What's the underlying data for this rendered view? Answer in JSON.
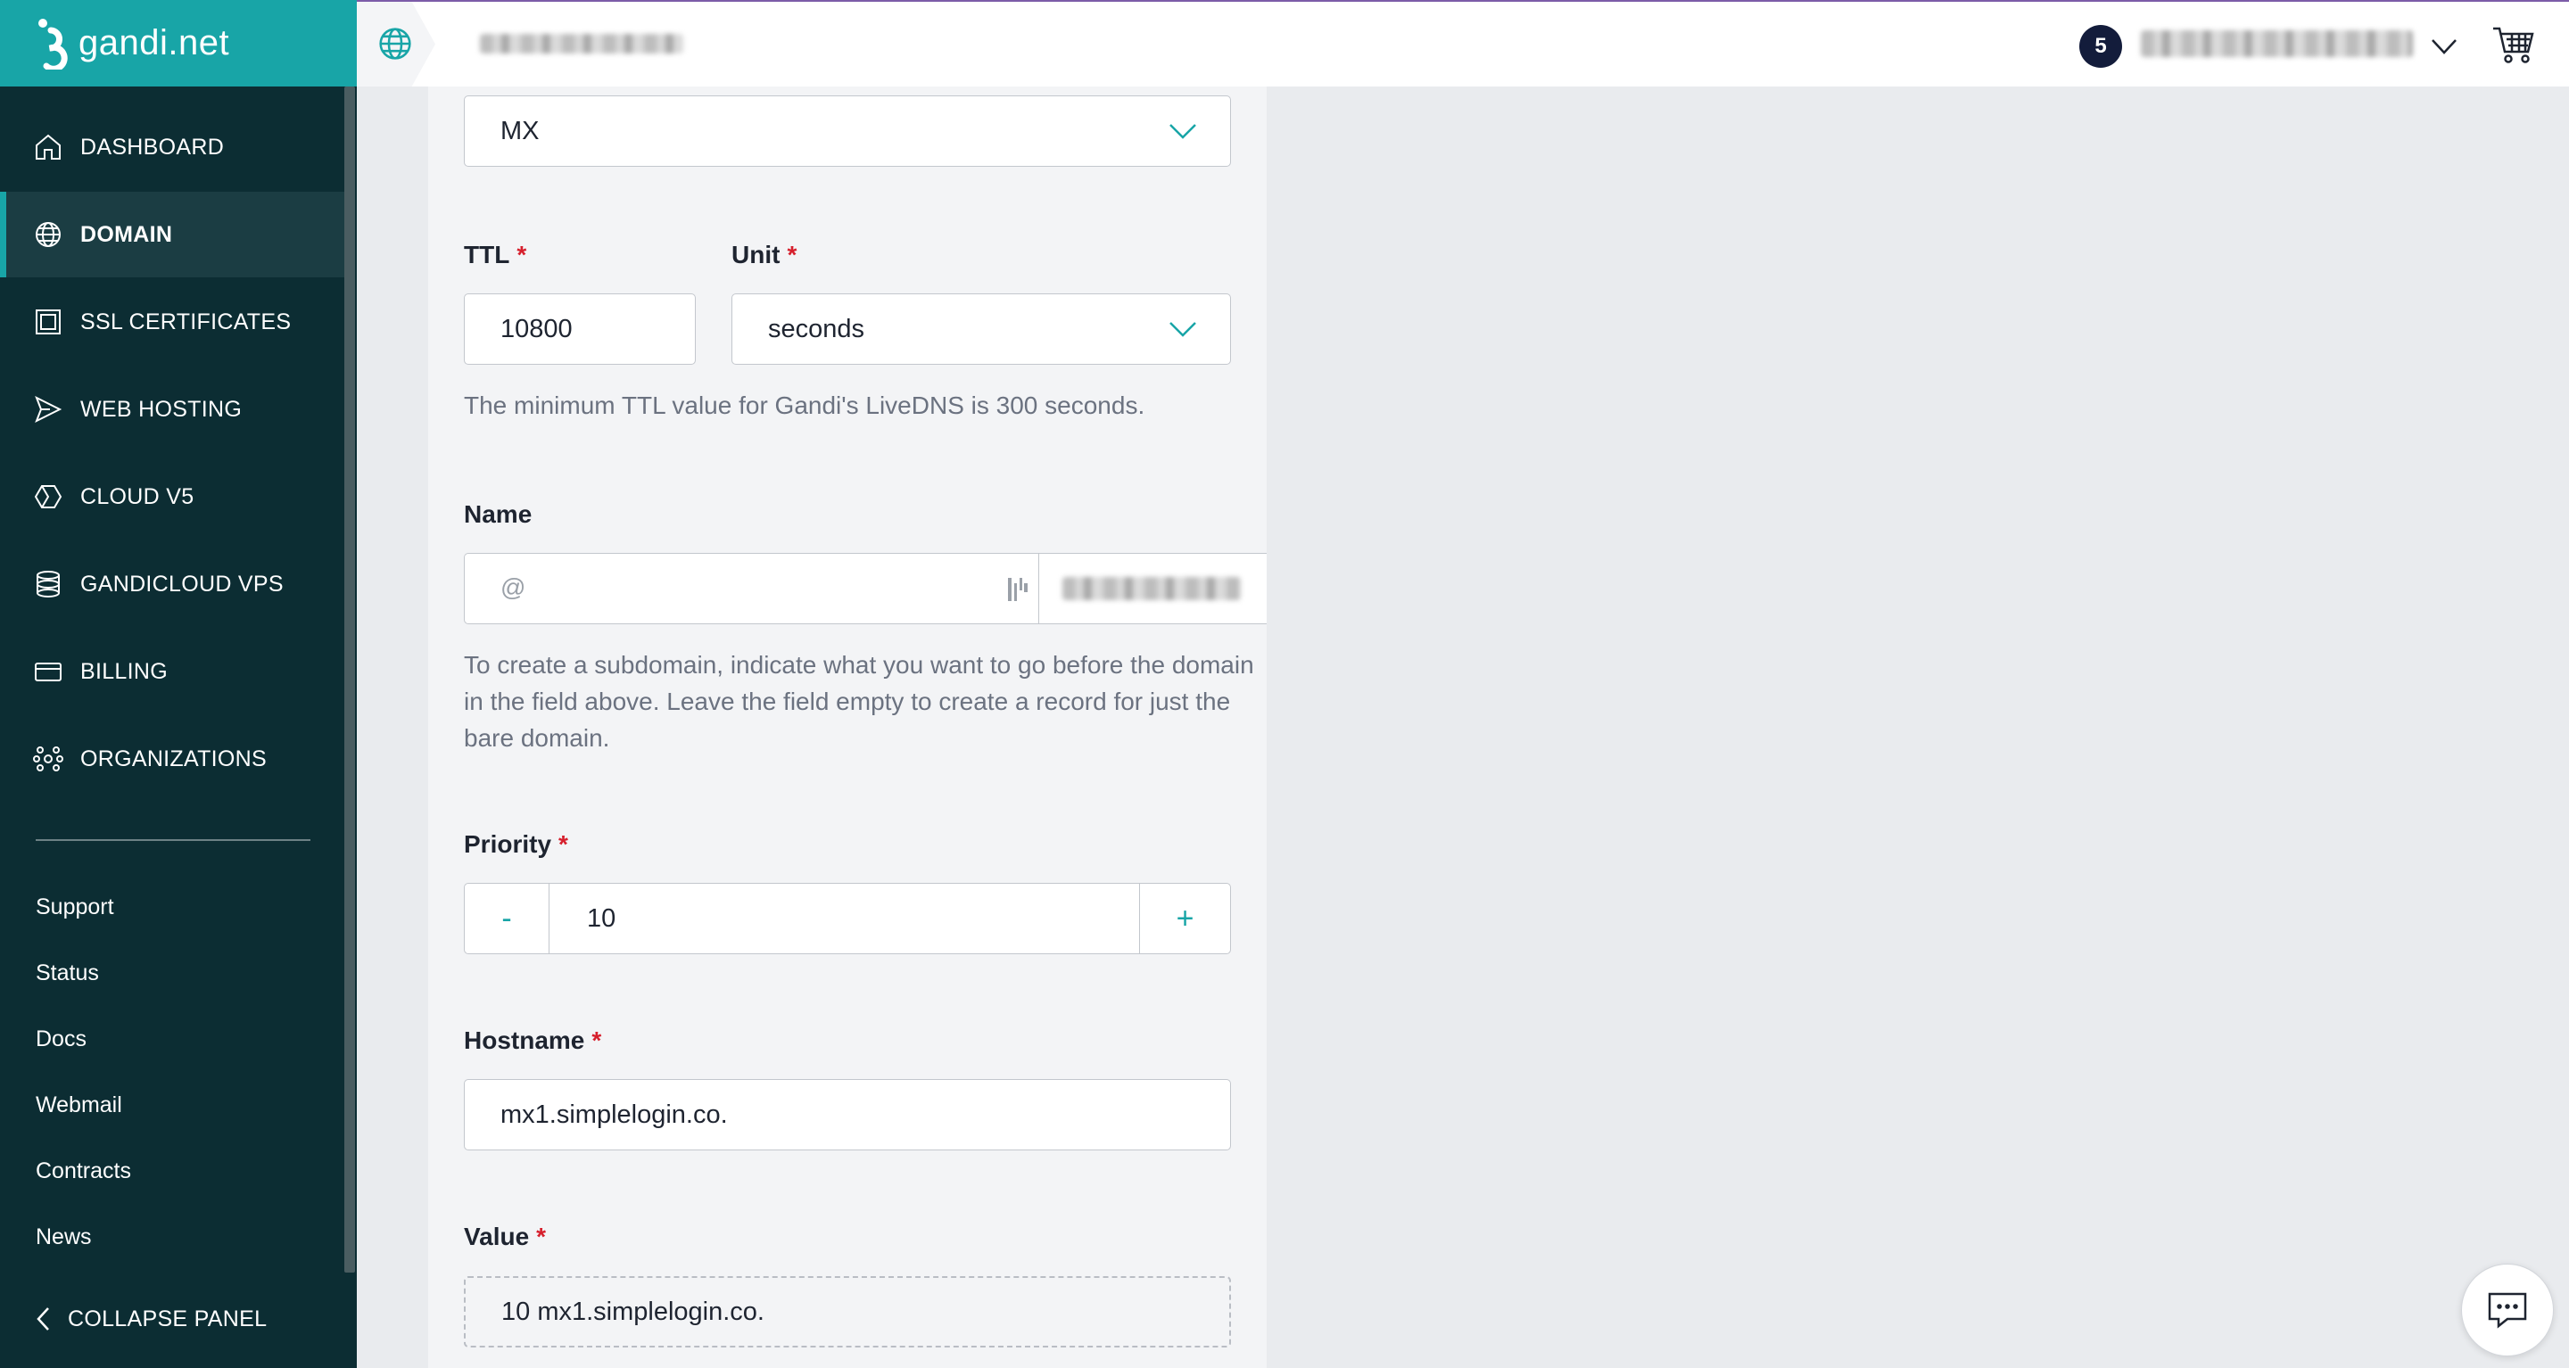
{
  "brand": {
    "name": "gandi.net"
  },
  "colors": {
    "accent": "#18a5a7",
    "sidebar_bg": "#0c2d33",
    "required": "#d61f2c"
  },
  "sidebar": {
    "nav": [
      {
        "label": "DASHBOARD",
        "icon": "home-icon"
      },
      {
        "label": "DOMAIN",
        "icon": "globe-icon",
        "active": true
      },
      {
        "label": "SSL CERTIFICATES",
        "icon": "certificate-icon"
      },
      {
        "label": "WEB HOSTING",
        "icon": "send-icon"
      },
      {
        "label": "CLOUD V5",
        "icon": "cloud-hexagon-icon"
      },
      {
        "label": "GANDICLOUD VPS",
        "icon": "server-stack-icon"
      },
      {
        "label": "BILLING",
        "icon": "credit-card-icon"
      },
      {
        "label": "ORGANIZATIONS",
        "icon": "network-icon"
      }
    ],
    "links": [
      "Support",
      "Status",
      "Docs",
      "Webmail",
      "Contracts",
      "News"
    ],
    "collapse_label": "COLLAPSE PANEL"
  },
  "topbar": {
    "notification_count": "5"
  },
  "form": {
    "type_value": "MX",
    "ttl": {
      "label": "TTL",
      "value": "10800"
    },
    "unit": {
      "label": "Unit",
      "value": "seconds"
    },
    "ttl_help": "The minimum TTL value for Gandi's LiveDNS is 300 seconds.",
    "name": {
      "label": "Name",
      "placeholder": "@",
      "help": "To create a subdomain, indicate what you want to go before the domain in the field above. Leave the field empty to create a record for just the bare domain."
    },
    "priority": {
      "label": "Priority",
      "value": "10",
      "minus": "-",
      "plus": "+"
    },
    "hostname": {
      "label": "Hostname",
      "value": "mx1.simplelogin.co."
    },
    "value": {
      "label": "Value",
      "value": "10 mx1.simplelogin.co."
    },
    "required_mark": "*"
  }
}
